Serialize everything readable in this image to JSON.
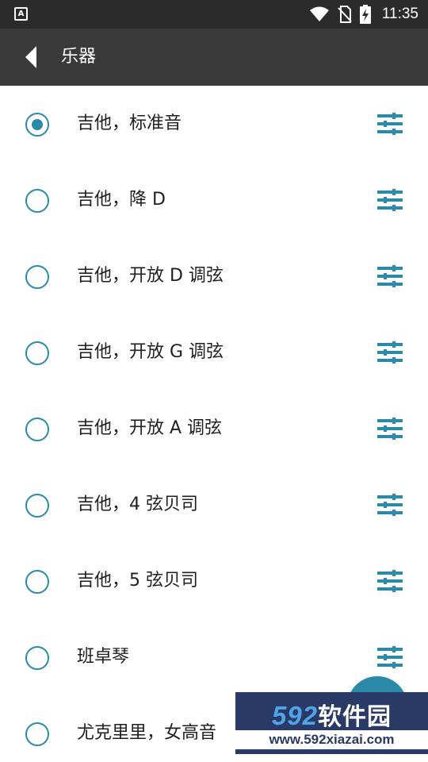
{
  "status_bar": {
    "app_badge": "A",
    "time": "11:35",
    "icons": [
      "wifi-icon",
      "no-sim-icon",
      "battery-charging-icon"
    ]
  },
  "app_bar": {
    "title": "乐器",
    "back_icon": "back-arrow-icon"
  },
  "accent_color": "#2a8aa8",
  "instruments": [
    {
      "label": "吉他，标准音",
      "selected": true
    },
    {
      "label": "吉他，降 D",
      "selected": false
    },
    {
      "label": "吉他，开放 D 调弦",
      "selected": false
    },
    {
      "label": "吉他，开放 G 调弦",
      "selected": false
    },
    {
      "label": "吉他，开放 A 调弦",
      "selected": false
    },
    {
      "label": "吉他，4 弦贝司",
      "selected": false
    },
    {
      "label": "吉他，5 弦贝司",
      "selected": false
    },
    {
      "label": "班卓琴",
      "selected": false
    },
    {
      "label": "尤克里里，女高音",
      "selected": false
    }
  ],
  "watermark": {
    "number": "592",
    "text": "软件园",
    "url": "www.592xiazai.com"
  }
}
